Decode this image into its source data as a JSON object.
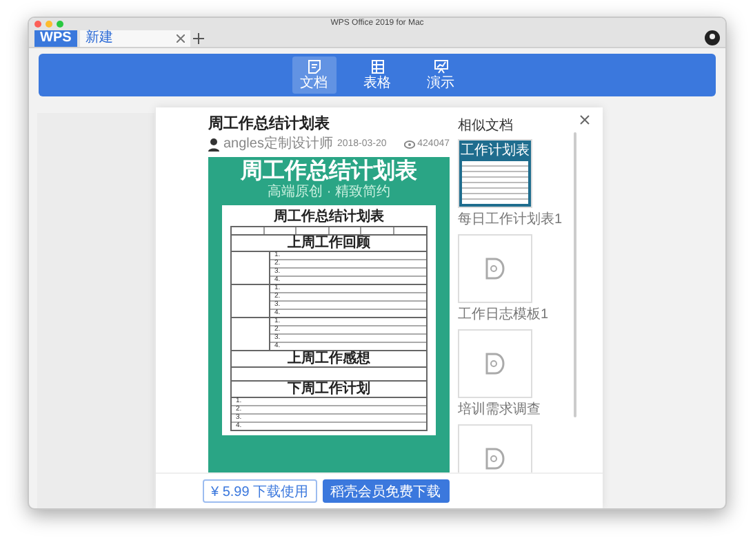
{
  "window": {
    "title": "WPS Office 2019 for Mac"
  },
  "tabs": [
    {
      "label": "WPS",
      "kind": "home",
      "selected": false
    },
    {
      "label": "新建",
      "kind": "doc",
      "selected": true
    }
  ],
  "app_tabs": [
    {
      "label": "文档",
      "kind": "doc",
      "selected": true
    },
    {
      "label": "表格",
      "kind": "sheet",
      "selected": false
    },
    {
      "label": "演示",
      "kind": "slides",
      "selected": false
    }
  ],
  "modal": {
    "title": "周工作总结计划表",
    "author": "angles定制设计师",
    "date": "2018-03-20",
    "views": "424047",
    "preview": {
      "heading": "周工作总结计划表",
      "subtitle": "高端原创 · 精致简约",
      "sheet_title": "周工作总结计划表",
      "sections": [
        {
          "kind": "groups",
          "title": "上周工作回顾",
          "groups": [
            [
              "1.",
              "2.",
              "3.",
              "4."
            ],
            [
              "1.",
              "2.",
              "3.",
              "4."
            ],
            [
              "1.",
              "2.",
              "3.",
              "4."
            ]
          ]
        },
        {
          "kind": "note",
          "title": "上周工作感想"
        },
        {
          "kind": "rows",
          "title": "下周工作计划",
          "rows": [
            "1.",
            "2.",
            "3.",
            "4."
          ]
        }
      ]
    },
    "similar": {
      "title": "相似文档",
      "items": [
        {
          "kind": "preview",
          "caption": "每日工作计划表1",
          "thumb_title": "工作计划表"
        },
        {
          "kind": "placeholder",
          "caption": "工作日志模板1"
        },
        {
          "kind": "placeholder",
          "caption": "培训需求调查"
        },
        {
          "kind": "placeholder"
        }
      ]
    },
    "buttons": [
      {
        "kind": "outline",
        "label": "¥ 5.99 下载使用"
      },
      {
        "kind": "primary",
        "label": "稻壳会员免费下载"
      }
    ]
  }
}
